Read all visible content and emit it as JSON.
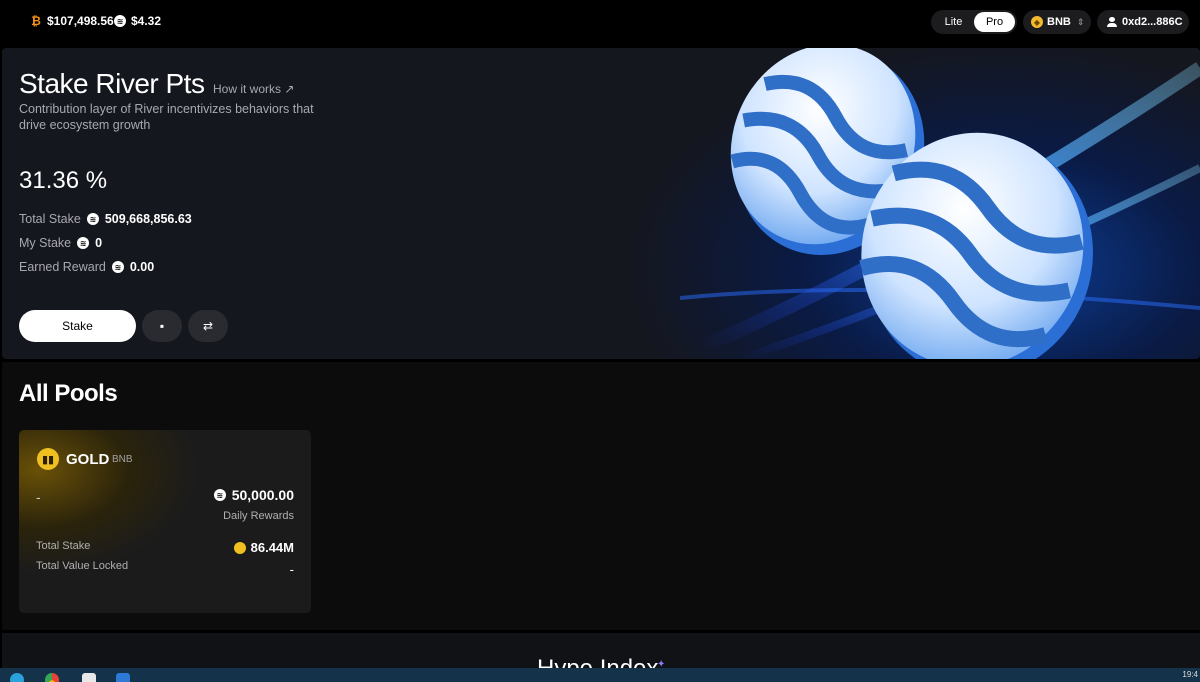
{
  "topbar": {
    "btc_price": "$107,498.56",
    "river_price": "$4.32",
    "mode_options": [
      "Lite",
      "Pro"
    ],
    "mode_selected": "Pro",
    "chain": "BNB",
    "wallet_address": "0xd2...886C"
  },
  "hero": {
    "title": "Stake River Pts",
    "how_link": "How it works ↗",
    "description": "Contribution layer of River incentivizes behaviors that drive ecosystem growth",
    "apr": "31.36 %",
    "stats": [
      {
        "label": "Total Stake",
        "value": "509,668,856.63"
      },
      {
        "label": "My Stake",
        "value": "0"
      },
      {
        "label": "Earned Reward",
        "value": "0.00"
      }
    ],
    "stake_button": "Stake",
    "wallet_button_icon": "wallet-icon",
    "swap_button_icon": "swap-icon"
  },
  "pools": {
    "title": "All Pools",
    "items": [
      {
        "name": "GOLD",
        "chain": "BNB",
        "apr": "-",
        "daily_rewards_value": "50,000.00",
        "daily_rewards_label": "Daily Rewards",
        "total_stake_label": "Total Stake",
        "total_stake_value": "86.44M",
        "tvl_label": "Total Value Locked",
        "tvl_value": "-"
      }
    ]
  },
  "hype": {
    "title": "Hype Index"
  },
  "taskbar": {
    "icons": [
      "telegram-icon",
      "chrome-icon",
      "notes-icon",
      "vscode-icon"
    ],
    "clock": "19:4"
  },
  "colors": {
    "accent": "#ffffff",
    "gold": "#f0c020",
    "bnb": "#f3ba2f",
    "btc": "#f7931a",
    "hero_glow": "#0c3f9a"
  }
}
